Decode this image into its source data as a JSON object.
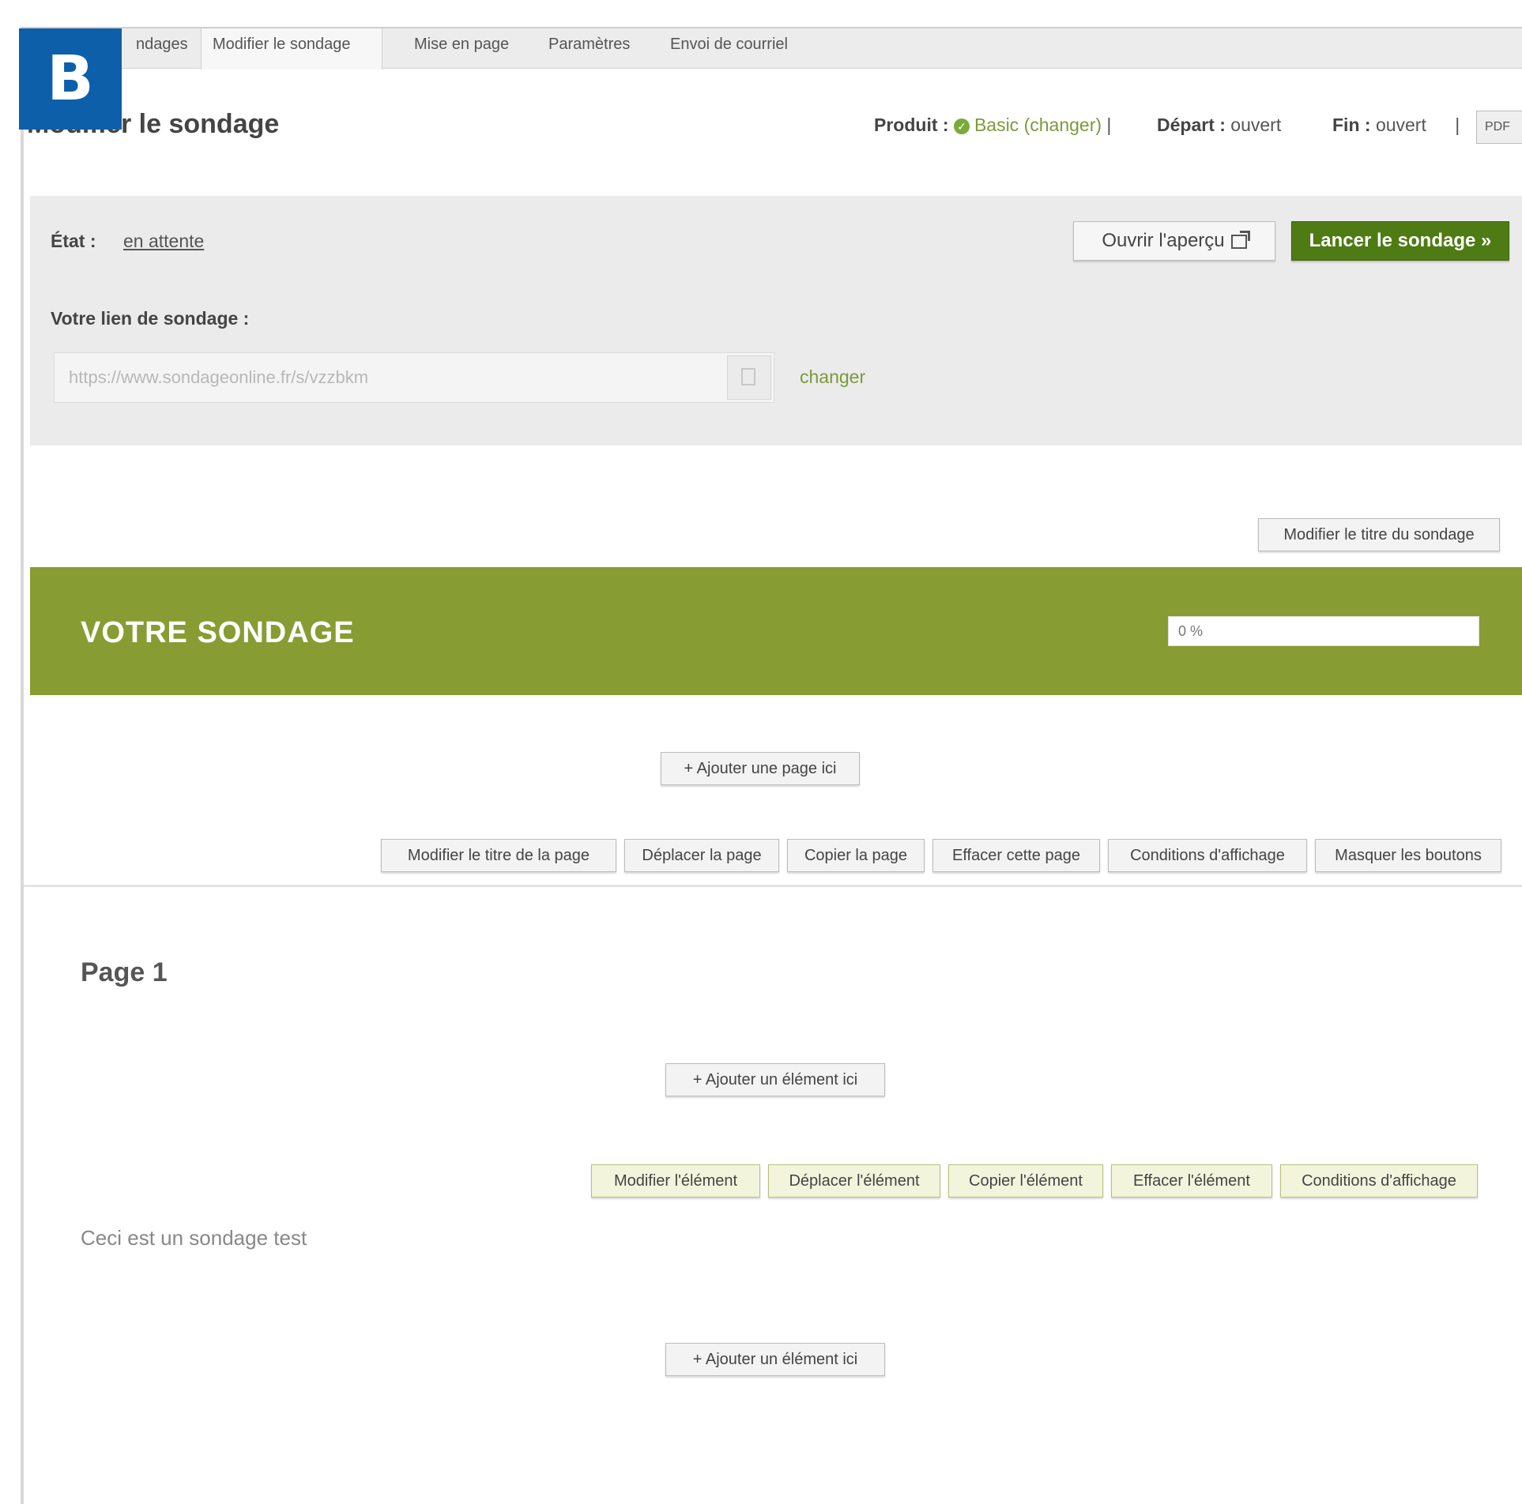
{
  "badge": "B",
  "tabs": [
    {
      "label": "ndages"
    },
    {
      "label": "Modifier le sondage"
    },
    {
      "label": "Mise en page"
    },
    {
      "label": "Paramètres"
    },
    {
      "label": "Envoi de courriel"
    }
  ],
  "heading": {
    "visible": "le sondage",
    "hidden": "Modifier "
  },
  "meta": {
    "product_label": "Produit :",
    "product_value": "Basic",
    "product_change": "(changer)",
    "separator": "|",
    "start_label": "Départ :",
    "start_value": "ouvert",
    "end_label": "Fin :",
    "end_value": "ouvert",
    "pdf": "PDF"
  },
  "state": {
    "label": "État :",
    "value": "en attente",
    "preview_button": "Ouvrir l'aperçu",
    "launch_button": "Lancer le sondage »"
  },
  "link": {
    "label": "Votre lien de sondage :",
    "url": "https://www.sondageonline.fr/s/vzzbkm",
    "change": "changer"
  },
  "edit_title_button": "Modifier le titre du sondage",
  "banner": {
    "title": "VOTRE SONDAGE",
    "progress": 0,
    "progress_text": "0 %"
  },
  "add_page_button": "+ Ajouter une page ici",
  "page_actions": [
    "Modifier le titre de la page",
    "Déplacer la page",
    "Copier la page",
    "Effacer cette page",
    "Conditions d'affichage",
    "Masquer les boutons"
  ],
  "page": {
    "title": "Page 1",
    "add_element_button": "+ Ajouter un élément ici",
    "element_actions": [
      "Modifier l'élément",
      "Déplacer l'élément",
      "Copier l'élément",
      "Effacer l'élément",
      "Conditions d'affichage"
    ],
    "element_text": "Ceci est un sondage test",
    "add_element_button_2": "+ Ajouter un élément ici"
  },
  "colors": {
    "badge": "#0d5faa",
    "banner": "#879c33",
    "launch": "#4e7b14",
    "link": "#7b9a3a"
  },
  "icons": [
    "check-circle-icon",
    "external-link-icon",
    "copy-icon"
  ]
}
